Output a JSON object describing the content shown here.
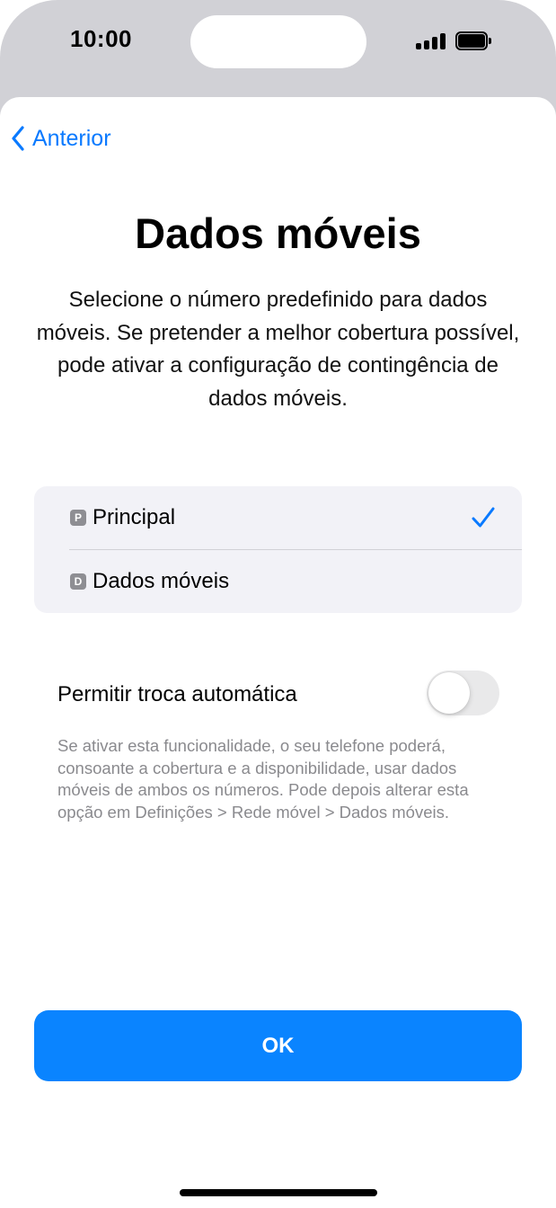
{
  "status_bar": {
    "time": "10:00",
    "icons": [
      "signal-icon",
      "battery-icon"
    ]
  },
  "nav": {
    "back_label": "Anterior",
    "back_icon": "chevron-left-icon"
  },
  "header": {
    "title": "Dados móveis",
    "subtitle": "Selecione o número predefinido para dados móveis. Se pretender a melhor cobertura possível, pode ativar a configuração de contingência de dados móveis."
  },
  "lines": {
    "items": [
      {
        "badge": "P",
        "label": "Principal",
        "selected": true
      },
      {
        "badge": "D",
        "label": "Dados móveis",
        "selected": false
      }
    ]
  },
  "auto_switch": {
    "label": "Permitir troca automática",
    "enabled": false,
    "footnote": "Se ativar esta funcionalidade, o seu telefone poderá, consoante a cobertura e a disponibilidade, usar dados móveis de ambos os números. Pode depois alterar esta opção em Definições > Rede móvel > Dados móveis."
  },
  "actions": {
    "ok_label": "OK"
  },
  "colors": {
    "accent": "#0a7aff",
    "button": "#0a84ff",
    "group_background": "#f2f2f7",
    "toggle_off": "#e9e9ea",
    "footnote_text": "#8a8a8e"
  }
}
